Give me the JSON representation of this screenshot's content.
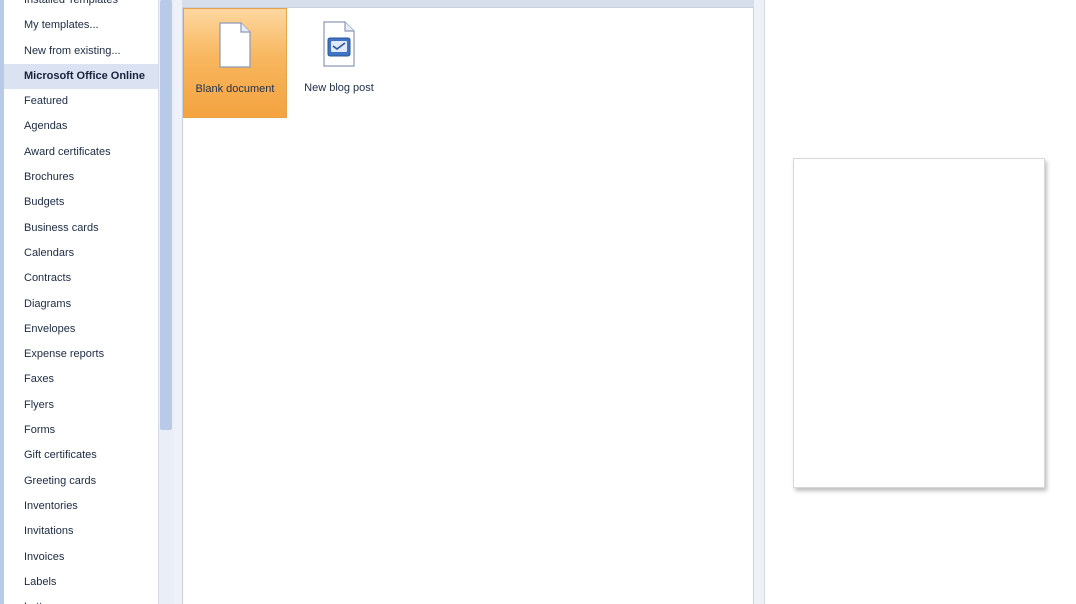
{
  "categories": {
    "items": [
      {
        "label": "Installed Templates",
        "selected": false
      },
      {
        "label": "My templates...",
        "selected": false
      },
      {
        "label": "New from existing...",
        "selected": false
      },
      {
        "label": "Microsoft Office Online",
        "selected": true
      },
      {
        "label": "Featured",
        "selected": false
      },
      {
        "label": "Agendas",
        "selected": false
      },
      {
        "label": "Award certificates",
        "selected": false
      },
      {
        "label": "Brochures",
        "selected": false
      },
      {
        "label": "Budgets",
        "selected": false
      },
      {
        "label": "Business cards",
        "selected": false
      },
      {
        "label": "Calendars",
        "selected": false
      },
      {
        "label": "Contracts",
        "selected": false
      },
      {
        "label": "Diagrams",
        "selected": false
      },
      {
        "label": "Envelopes",
        "selected": false
      },
      {
        "label": "Expense reports",
        "selected": false
      },
      {
        "label": "Faxes",
        "selected": false
      },
      {
        "label": "Flyers",
        "selected": false
      },
      {
        "label": "Forms",
        "selected": false
      },
      {
        "label": "Gift certificates",
        "selected": false
      },
      {
        "label": "Greeting cards",
        "selected": false
      },
      {
        "label": "Inventories",
        "selected": false
      },
      {
        "label": "Invitations",
        "selected": false
      },
      {
        "label": "Invoices",
        "selected": false
      },
      {
        "label": "Labels",
        "selected": false
      },
      {
        "label": "Letters",
        "selected": false
      }
    ]
  },
  "gallery": {
    "templates": [
      {
        "label": "Blank document",
        "icon": "blank-document-icon",
        "selected": true
      },
      {
        "label": "New blog post",
        "icon": "blog-post-icon",
        "selected": false
      }
    ]
  },
  "colors": {
    "selection_orange": "#f8b65e",
    "category_selected_bg": "#dbe3f2",
    "frame_blue": "#b9c9e8"
  }
}
